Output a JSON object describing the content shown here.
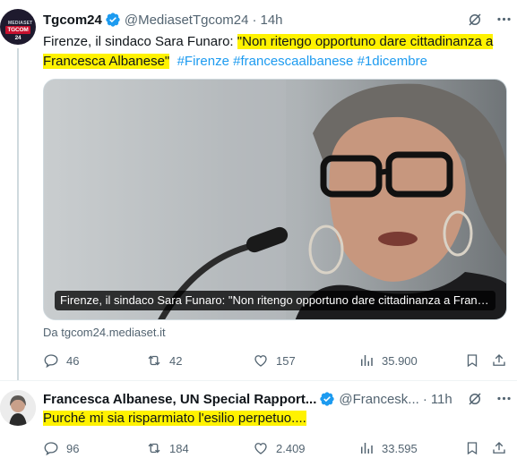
{
  "tweets": [
    {
      "author_name": "Tgcom24",
      "handle": "@MediasetTgcom24",
      "separator": "·",
      "time": "14h",
      "avatar_text_top": "MEDIASET",
      "avatar_text_bottom": "TGCOM 24",
      "text_plain": "Firenze, il sindaco Sara Funaro: ",
      "text_highlight_1": "\"Non ritengo opportuno dare cittadinanza a",
      "text_highlight_2": "Francesca Albanese\"",
      "hashtags": [
        "#Firenze",
        "#francescaalbanese",
        "#1dicembre"
      ],
      "media_caption": "Firenze, il sindaco Sara Funaro: \"Non ritengo opportuno dare cittadinanza a Francesca Albanese\"",
      "source": "Da tgcom24.mediaset.it",
      "replies": "46",
      "reposts": "42",
      "likes": "157",
      "views": "35.900"
    },
    {
      "author_name": "Francesca Albanese, UN Special Rapport...",
      "handle": "@Francesk...",
      "separator": "·",
      "time": "11h",
      "text_highlight": "Purché mi sia risparmiato l'esilio perpetuo....",
      "replies": "96",
      "reposts": "184",
      "likes": "2.409",
      "views": "33.595"
    }
  ],
  "colors": {
    "highlight": "#fff200",
    "link": "#1d9bf0",
    "verified": "#1d9bf0",
    "muted": "#536471",
    "brand_red": "#c8102e"
  },
  "icons": [
    "verified-badge-icon",
    "grok-icon",
    "more-icon",
    "reply-icon",
    "repost-icon",
    "like-icon",
    "views-icon",
    "bookmark-icon",
    "share-icon"
  ]
}
